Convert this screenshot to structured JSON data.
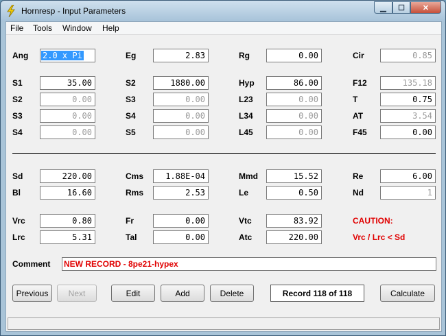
{
  "window": {
    "title": "Hornresp - Input Parameters"
  },
  "menu": [
    "File",
    "Tools",
    "Window",
    "Help"
  ],
  "params": {
    "Ang": {
      "label": "Ang",
      "value": "2.0 x Pi"
    },
    "Eg": {
      "label": "Eg",
      "value": "2.83"
    },
    "Rg": {
      "label": "Rg",
      "value": "0.00"
    },
    "Cir": {
      "label": "Cir",
      "value": "0.85"
    },
    "S1": {
      "label": "S1",
      "value": "35.00"
    },
    "S2a": {
      "label": "S2",
      "value": "1880.00"
    },
    "Hyp": {
      "label": "Hyp",
      "value": "86.00"
    },
    "F12": {
      "label": "F12",
      "value": "135.18"
    },
    "S2b": {
      "label": "S2",
      "value": "0.00"
    },
    "S3a": {
      "label": "S3",
      "value": "0.00"
    },
    "L23": {
      "label": "L23",
      "value": "0.00"
    },
    "T": {
      "label": "T",
      "value": "0.75"
    },
    "S3b": {
      "label": "S3",
      "value": "0.00"
    },
    "S4a": {
      "label": "S4",
      "value": "0.00"
    },
    "L34": {
      "label": "L34",
      "value": "0.00"
    },
    "AT": {
      "label": "AT",
      "value": "3.54"
    },
    "S4b": {
      "label": "S4",
      "value": "0.00"
    },
    "S5": {
      "label": "S5",
      "value": "0.00"
    },
    "L45": {
      "label": "L45",
      "value": "0.00"
    },
    "F45": {
      "label": "F45",
      "value": "0.00"
    },
    "Sd": {
      "label": "Sd",
      "value": "220.00"
    },
    "Cms": {
      "label": "Cms",
      "value": "1.88E-04"
    },
    "Mmd": {
      "label": "Mmd",
      "value": "15.52"
    },
    "Re": {
      "label": "Re",
      "value": "6.00"
    },
    "Bl": {
      "label": "Bl",
      "value": "16.60"
    },
    "Rms": {
      "label": "Rms",
      "value": "2.53"
    },
    "Le": {
      "label": "Le",
      "value": "0.50"
    },
    "Nd": {
      "label": "Nd",
      "value": "1"
    },
    "Vrc": {
      "label": "Vrc",
      "value": "0.80"
    },
    "Fr": {
      "label": "Fr",
      "value": "0.00"
    },
    "Vtc": {
      "label": "Vtc",
      "value": "83.92"
    },
    "Lrc": {
      "label": "Lrc",
      "value": "5.31"
    },
    "Tal": {
      "label": "Tal",
      "value": "0.00"
    },
    "Atc": {
      "label": "Atc",
      "value": "220.00"
    }
  },
  "caution": {
    "title": "CAUTION:",
    "message": "Vrc / Lrc < Sd"
  },
  "comment": {
    "label": "Comment",
    "value": "NEW RECORD - 8pe21-hypex"
  },
  "buttons": {
    "previous": "Previous",
    "next": "Next",
    "edit": "Edit",
    "add": "Add",
    "delete": "Delete",
    "calculate": "Calculate"
  },
  "record": "Record 118 of 118",
  "colors": {
    "accent": "#3399ff",
    "warning": "#e00000"
  }
}
